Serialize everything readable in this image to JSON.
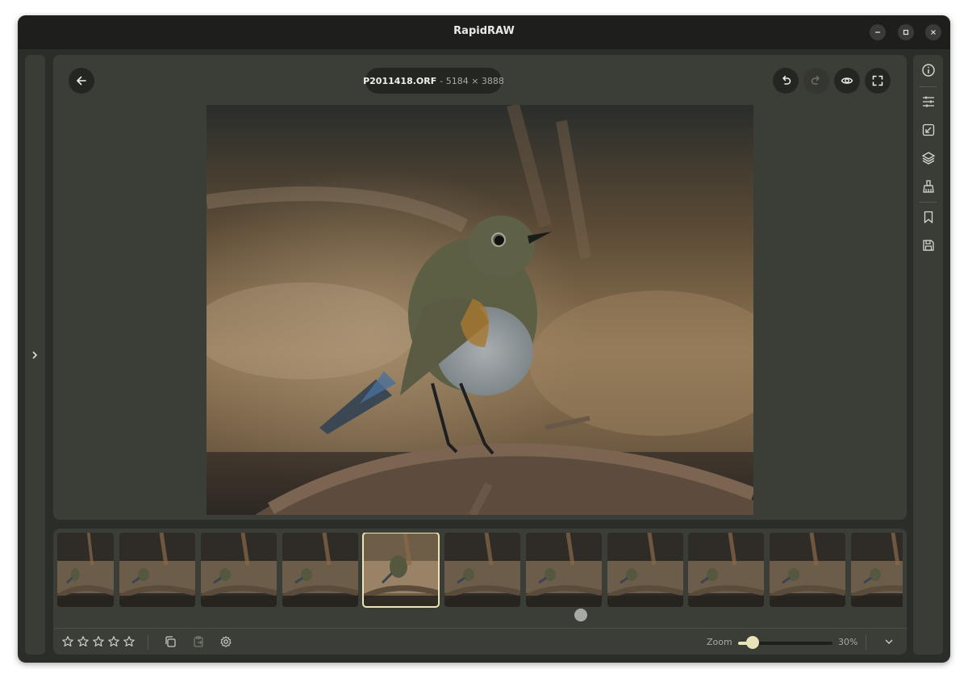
{
  "window": {
    "title": "RapidRAW"
  },
  "editor": {
    "file_name": "P2011418.ORF",
    "file_dims": "- 5184 × 3888"
  },
  "toolbar": {
    "icons": [
      "back-arrow-icon",
      "undo-icon",
      "redo-icon",
      "eye-icon",
      "fullscreen-icon"
    ]
  },
  "rightbar": {
    "icons": [
      "info-icon",
      "adjustments-icon",
      "crop-icon",
      "layers-icon",
      "retouch-icon",
      "bookmark-icon",
      "save-icon"
    ]
  },
  "filmstrip": {
    "thumbnail_count": 11,
    "selected_index": 4
  },
  "bottombar": {
    "rating": 0,
    "rating_max": 5,
    "zoom_label": "Zoom",
    "zoom_value": "30%",
    "zoom_fraction": 0.15
  },
  "colors": {
    "accent": "#e8e3b8",
    "panel": "#3b3e37",
    "background": "#2b2d28"
  }
}
